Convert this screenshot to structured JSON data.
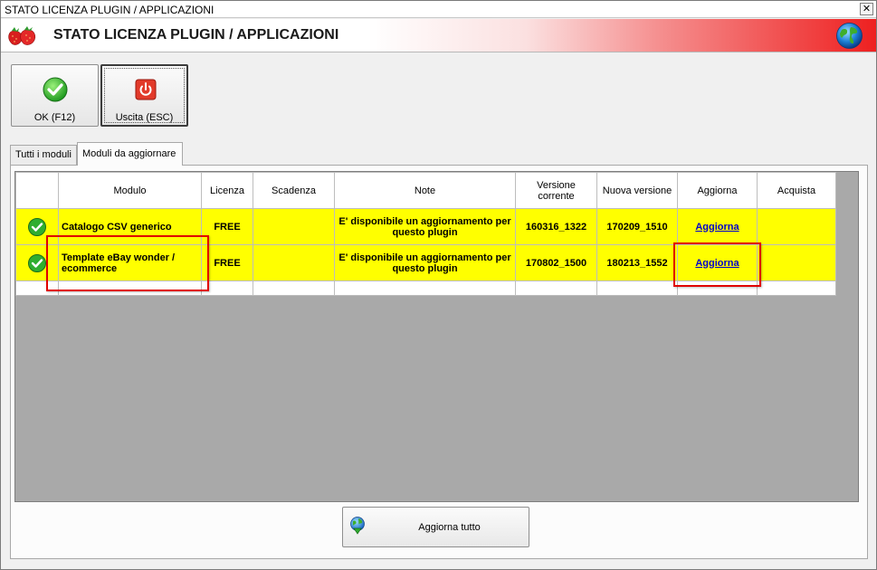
{
  "window": {
    "title": "STATO LICENZA PLUGIN / APPLICAZIONI",
    "close_glyph": "✕"
  },
  "banner": {
    "heading": "STATO LICENZA PLUGIN / APPLICAZIONI",
    "logo_icon": "strawberry-icon",
    "globe_icon": "globe-icon"
  },
  "toolbar": {
    "ok_label": "OK (F12)",
    "exit_label": "Uscita (ESC)"
  },
  "tabs": [
    {
      "label": "Tutti i moduli",
      "active": false
    },
    {
      "label": "Moduli da aggiornare",
      "active": true
    }
  ],
  "table": {
    "columns": [
      "",
      "Modulo",
      "Licenza",
      "Scadenza",
      "Note",
      "Versione corrente",
      "Nuova versione",
      "Aggiorna",
      "Acquista"
    ],
    "rows": [
      {
        "modulo": "Catalogo CSV generico",
        "licenza": "FREE",
        "scadenza": "",
        "note": "E' disponibile un aggiornamento per questo plugin",
        "versione_corrente": "160316_1322",
        "nuova_versione": "170209_1510",
        "aggiorna": "Aggiorna",
        "acquista": ""
      },
      {
        "modulo": "Template eBay wonder / ecommerce",
        "licenza": "FREE",
        "scadenza": "",
        "note": "E' disponibile un aggiornamento per questo plugin",
        "versione_corrente": "170802_1500",
        "nuova_versione": "180213_1552",
        "aggiorna": "Aggiorna",
        "acquista": ""
      }
    ]
  },
  "footer": {
    "update_all_label": "Aggiorna tutto"
  },
  "colors": {
    "row_highlight": "#ffff00",
    "annotation_box": "#e00000",
    "link": "#0000cc",
    "grid_background": "#a9a9a9"
  }
}
